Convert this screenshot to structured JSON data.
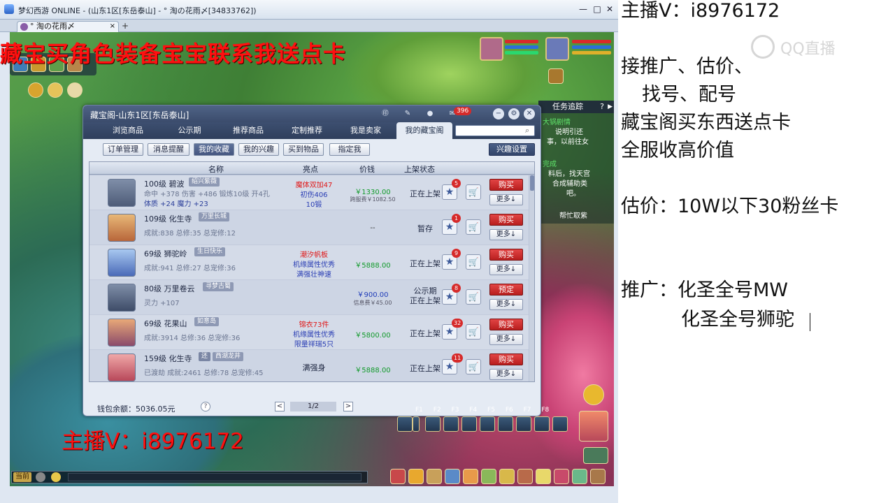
{
  "window": {
    "title": "梦幻西游 ONLINE - (山东1区[东岳泰山] - ° 淘の花雨〆[34833762])",
    "tab_label": "° 淘の花雨〆",
    "tab_close": "×",
    "tab_new": "+",
    "min": "—",
    "max": "□",
    "close": "✕"
  },
  "overlay": {
    "promo_top": "藏宝买角色装备宝宝联系我送点卡",
    "promo_bottom": "主播V：i8976172"
  },
  "task_panel": {
    "title": "任务追踪",
    "help": "?",
    "lines": [
      "大锅剧情",
      "说明引还",
      "事，以前往女",
      "完成",
      "料后，找天宫",
      "合成辅助类",
      "吧。",
      "帮忙取紫"
    ]
  },
  "dialog": {
    "title": "藏宝阁-山东1区[东岳泰山]",
    "mail_count": "396",
    "nav_tabs": [
      "浏览商品",
      "公示期",
      "推荐商品",
      "定制推荐",
      "我是卖家",
      "我的藏宝阁"
    ],
    "sub_tabs": [
      "订单管理",
      "消息提醒",
      "我的收藏",
      "我的兴趣",
      "买到物品",
      "指定我"
    ],
    "interest_settings": "兴趣设置",
    "columns": {
      "name": "名称",
      "highlight": "亮点",
      "price": "价钱",
      "status": "上架状态"
    },
    "buy_label_default": "购买",
    "more_label": "更多↓",
    "wallet": "钱包余额：5036.05元",
    "help": "?",
    "page_prev": "<",
    "page_next": ">",
    "page": "1/2",
    "rows": [
      {
        "name": "100级 碧波",
        "tag": "绍兴紫薇",
        "line1": "命中 +378 伤害 +486 锻炼10级 开4孔",
        "line2": "体质 +24 魔力 +23",
        "hl": [
          "魔体双加47",
          "初伤406",
          "10锻"
        ],
        "hl_colors": [
          "red",
          "blue",
          "blue"
        ],
        "price": "￥1330.00",
        "price_sub": "跨服费￥1082.50",
        "status": "正在上架",
        "fav": "5",
        "action": "购买"
      },
      {
        "name": "109级 化生寺",
        "tag": "万里长城",
        "line1": "成就:838 总修:35 总宠修:12",
        "line2": "",
        "hl": [],
        "hl_colors": [],
        "price": "--",
        "price_sub": "",
        "status": "暂存",
        "fav": "1",
        "action": "购买"
      },
      {
        "name": "69级 狮驼岭",
        "tag": "生日快乐",
        "line1": "成就:941 总修:27 总宠修:36",
        "line2": "",
        "hl": [
          "潮汐帆板",
          "机缘属性优秀",
          "满强壮神速"
        ],
        "hl_colors": [
          "red",
          "blue",
          "blue"
        ],
        "price": "￥5888.00",
        "price_sub": "",
        "status": "正在上架",
        "fav": "9",
        "action": "购买"
      },
      {
        "name": "80级 万里卷云",
        "tag": "寻梦古蜀",
        "line1": "灵力 +107",
        "line2": "",
        "hl": [],
        "hl_colors": [],
        "price": "￥900.00",
        "price_sub": "信息费￥45.00",
        "status": "公示期\n正在上架",
        "fav": "8",
        "action": "预定"
      },
      {
        "name": "69级 花果山",
        "tag": "如意岛",
        "line1": "成就:3914 总修:36 总宠修:36",
        "line2": "",
        "hl": [
          "锦衣73件",
          "机缘属性优秀",
          "限量祥瑞5只"
        ],
        "hl_colors": [
          "red",
          "blue",
          "blue"
        ],
        "price": "￥5800.00",
        "price_sub": "",
        "status": "正在上架",
        "fav": "32",
        "action": "购买"
      },
      {
        "name": "159级 化生寺",
        "tag": "西湖龙井",
        "tag_pre": "还",
        "line1": "已渡劫 成就:2461 总修:78 总宠修:45",
        "line2": "",
        "hl": [
          "满强身"
        ],
        "hl_colors": [
          "dark"
        ],
        "price": "￥5888.00",
        "price_sub": "",
        "status": "正在上架",
        "fav": "11",
        "action": "购买"
      }
    ]
  },
  "game_bottom": {
    "fkeys": "F1 F2 F3 F4 F5 F6 F7 F8",
    "chat_channel": "当前"
  },
  "streamer_panel": {
    "line1": "主播V：i8976172",
    "line2": "接推广、估价、",
    "line3": "找号、配号",
    "line4": "藏宝阁买东西送点卡",
    "line5": "全服收高价值",
    "line6": "估价：10W以下30粉丝卡",
    "line7": "推广：化圣全号MW",
    "line8": "化圣全号狮驼",
    "watermark": "QQ直播"
  }
}
